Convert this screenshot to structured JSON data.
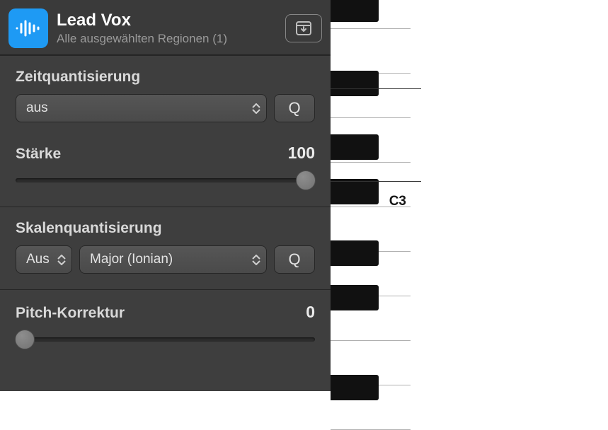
{
  "header": {
    "title": "Lead Vox",
    "subtitle": "Alle ausgewählten Regionen (1)"
  },
  "timeQuantize": {
    "label": "Zeitquantisierung",
    "value": "aus",
    "qButton": "Q"
  },
  "strength": {
    "label": "Stärke",
    "value": "100",
    "percent": 100
  },
  "scaleQuantize": {
    "label": "Skalenquantisierung",
    "root": "Aus",
    "scale": "Major (Ionian)",
    "qButton": "Q"
  },
  "pitchCorrection": {
    "label": "Pitch-Korrektur",
    "value": "0",
    "percent": 0
  },
  "piano": {
    "c3Label": "C3"
  },
  "icons": {
    "waveform": "waveform-icon",
    "download": "download-icon"
  }
}
